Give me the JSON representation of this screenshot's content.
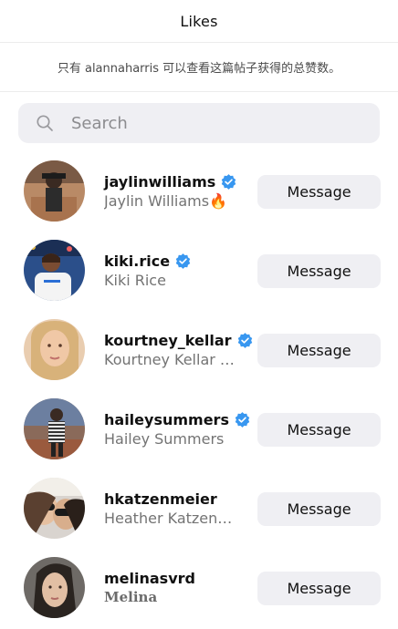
{
  "header": {
    "title": "Likes"
  },
  "notice": {
    "text": "只有 alannaharris 可以查看这篇帖子获得的总赞数。"
  },
  "search": {
    "placeholder": "Search",
    "icon": "search-icon"
  },
  "accent": {
    "verified_color": "#3897f0",
    "button_bg": "#efeff3"
  },
  "likes": [
    {
      "username": "jaylinwilliams",
      "full_name": "Jaylin Williams",
      "emoji": "🔥",
      "verified": true,
      "button": "Message"
    },
    {
      "username": "kiki.rice",
      "full_name": "Kiki Rice",
      "verified": true,
      "button": "Message"
    },
    {
      "username": "kourtney_kellar",
      "full_name": "Kourtney Kellar H...",
      "verified": true,
      "button": "Message"
    },
    {
      "username": "haileysummers",
      "full_name": "Hailey Summers",
      "verified": true,
      "button": "Message"
    },
    {
      "username": "hkatzenmeier",
      "full_name": "Heather Katzenm...",
      "verified": false,
      "button": "Message"
    },
    {
      "username": "melinasvrd",
      "full_name": "Melina",
      "verified": false,
      "button": "Message"
    }
  ]
}
